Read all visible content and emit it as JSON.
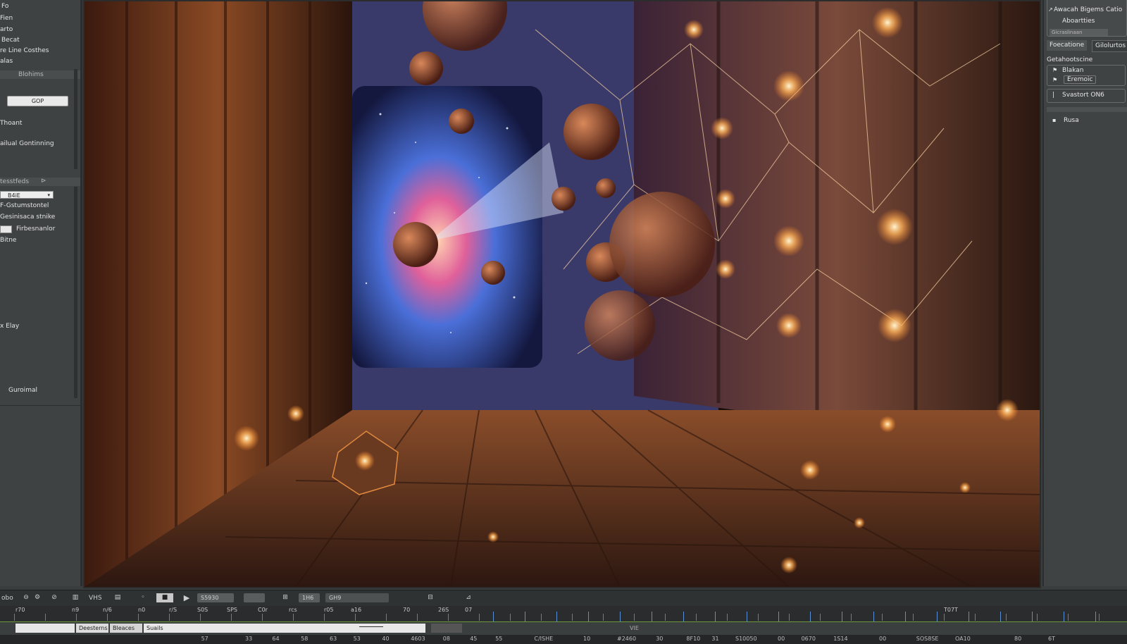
{
  "left_panel": {
    "top_items": [
      "Fo",
      "Fien",
      "arto",
      "Becat",
      "re Line Costhes",
      "alas"
    ],
    "section1_title": "Blohims",
    "gop_button": "GOP",
    "item_thoant": "Thoant",
    "item_continuing": "ailual Gontinning",
    "section2_title": "tesstfeds",
    "field_value": "B4iE",
    "item_gstumstontel": "F-Gstumstontel",
    "item_gesinisaca": "Gesinisaca stnike",
    "item_firbesnanlor": "Firbesnanlor",
    "item_bitne": "Bitne",
    "item_elay": "x Elay",
    "item_guroimal": "Guroimal"
  },
  "right_panel": {
    "header_line1": "Awacah Bigems Catio",
    "header_line2": "Aboartties",
    "header_field": "Gicraslinaan",
    "tab1": "Foecatione",
    "tab2": "Gilolurtos",
    "group_title": "Getahootscine",
    "item_blakan": "Blakan",
    "item_eremoic": "Eremoic",
    "item_svastort": "Svastort ON6",
    "item_rusa": "Rusa"
  },
  "toolbar": {
    "left_label": "obo",
    "icons": [
      "circle-s-icon",
      "settings-icon",
      "grid-icon",
      "vr-icon",
      "box-icon",
      "dot-icon",
      "stop-icon",
      "play-icon"
    ],
    "vhs_label": "VHS",
    "field1": "S5930",
    "field2": "1H6",
    "field3": "GH9"
  },
  "timeline": {
    "ruler_labels": [
      "r70",
      "n9",
      "n/6",
      "n0",
      "r/S",
      "S0S",
      "SPS",
      "C0r",
      "rcs",
      "r05",
      "a16",
      "70",
      "26S",
      "07",
      "T07T"
    ],
    "clip_labels": [
      "Deesterns",
      "Bleaces",
      "Suails"
    ],
    "vie_label": "VIE",
    "bottom_numbers": [
      "57",
      "33",
      "64",
      "58",
      "63",
      "53",
      "40",
      "4603",
      "08",
      "45",
      "55",
      "C/ISHE",
      "10",
      "#2460",
      "30",
      "8F10",
      "31",
      "S10050",
      "00",
      "0670",
      "1S14",
      "00",
      "SOS8SE",
      "OA10",
      "80",
      "6T"
    ]
  }
}
